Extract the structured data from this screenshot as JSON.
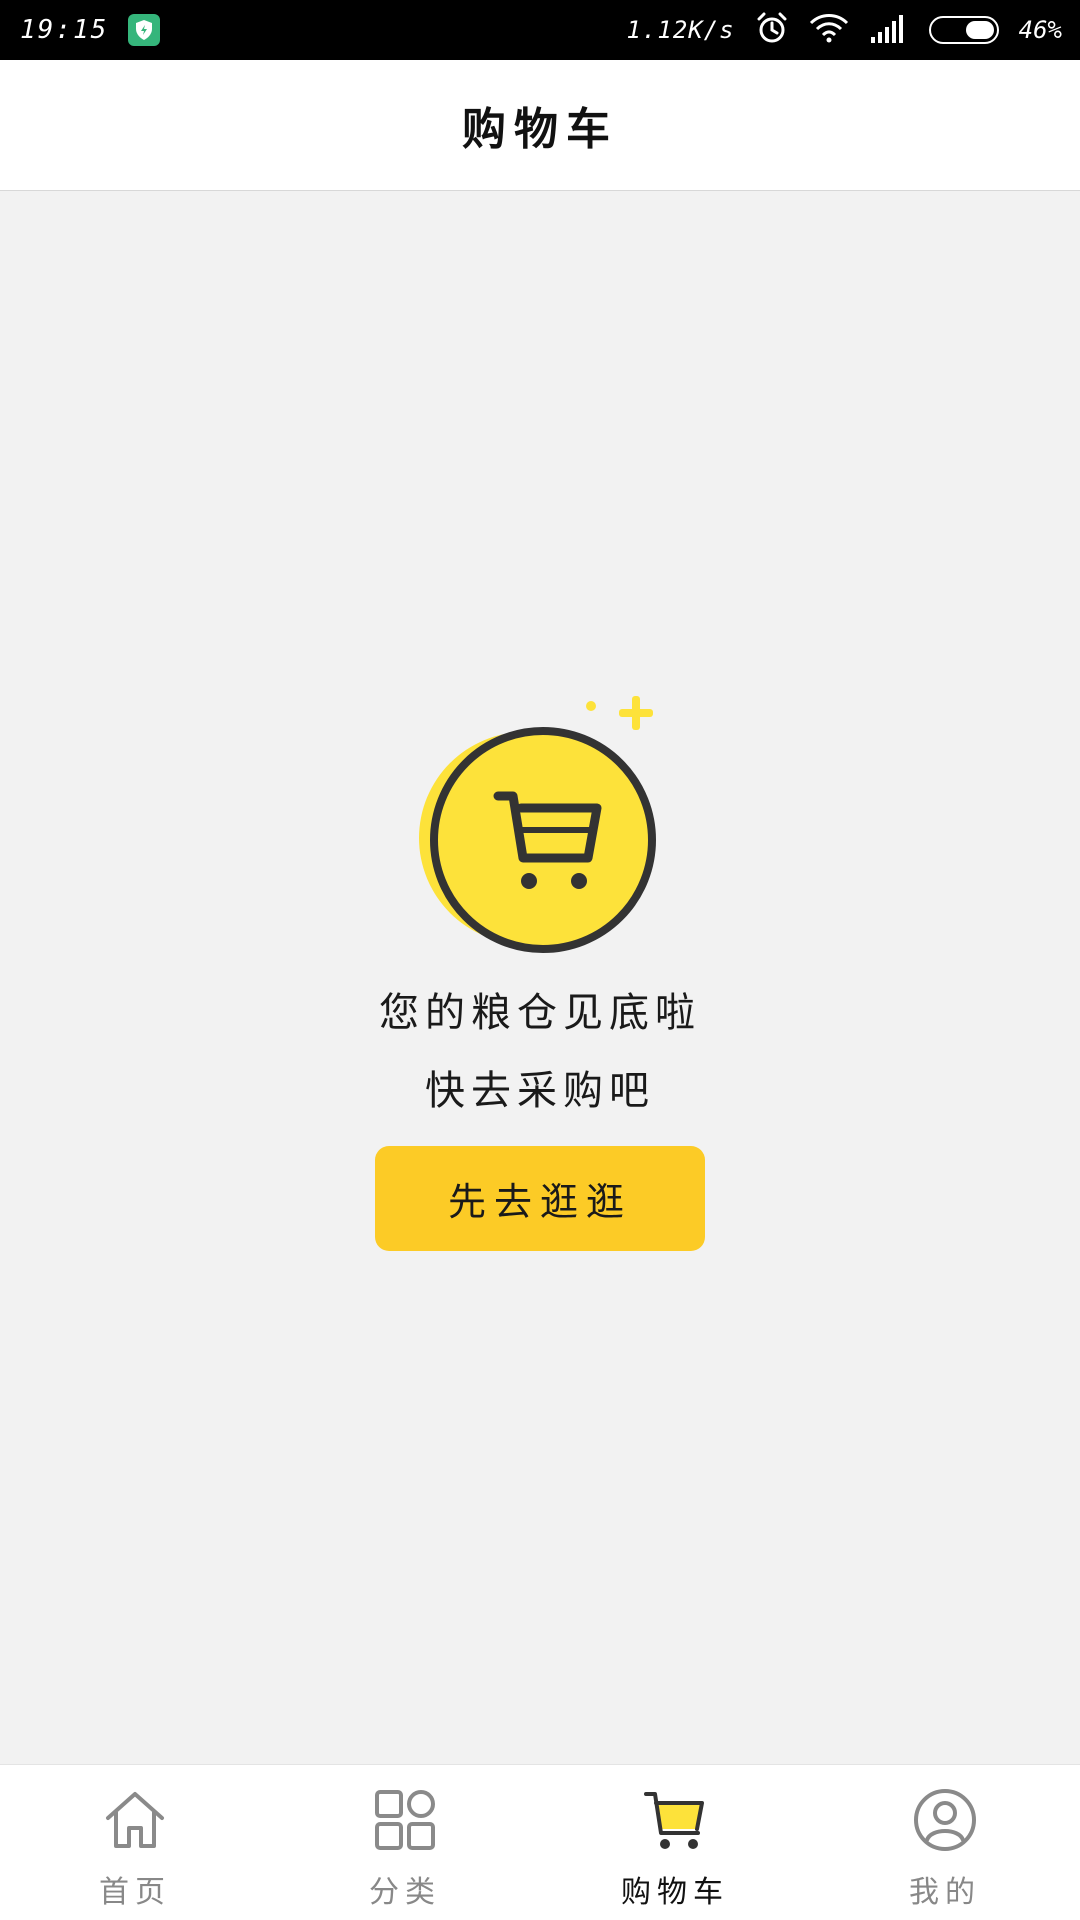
{
  "status_bar": {
    "time": "19:15",
    "net_speed": "1.12K/s",
    "battery": "46%",
    "battery_level": 0.46,
    "icons": [
      "shield-icon",
      "alarm-icon",
      "wifi-icon",
      "signal-icon",
      "battery-icon"
    ]
  },
  "header": {
    "title": "购物车"
  },
  "empty_state": {
    "line1": "您的粮仓见底啦",
    "line2": "快去采购吧",
    "button_label": "先去逛逛",
    "icon": "cart-icon"
  },
  "tabbar": {
    "items": [
      {
        "label": "首页",
        "icon": "home-icon",
        "active": false
      },
      {
        "label": "分类",
        "icon": "grid-icon",
        "active": false
      },
      {
        "label": "购物车",
        "icon": "cart-icon",
        "active": true
      },
      {
        "label": "我的",
        "icon": "profile-icon",
        "active": false
      }
    ]
  },
  "colors": {
    "accent_yellow": "#fccb26",
    "icon_yellow": "#fde23a",
    "background": "#f2f2f2",
    "status_bar": "#000000",
    "shield": "#35b57b"
  }
}
